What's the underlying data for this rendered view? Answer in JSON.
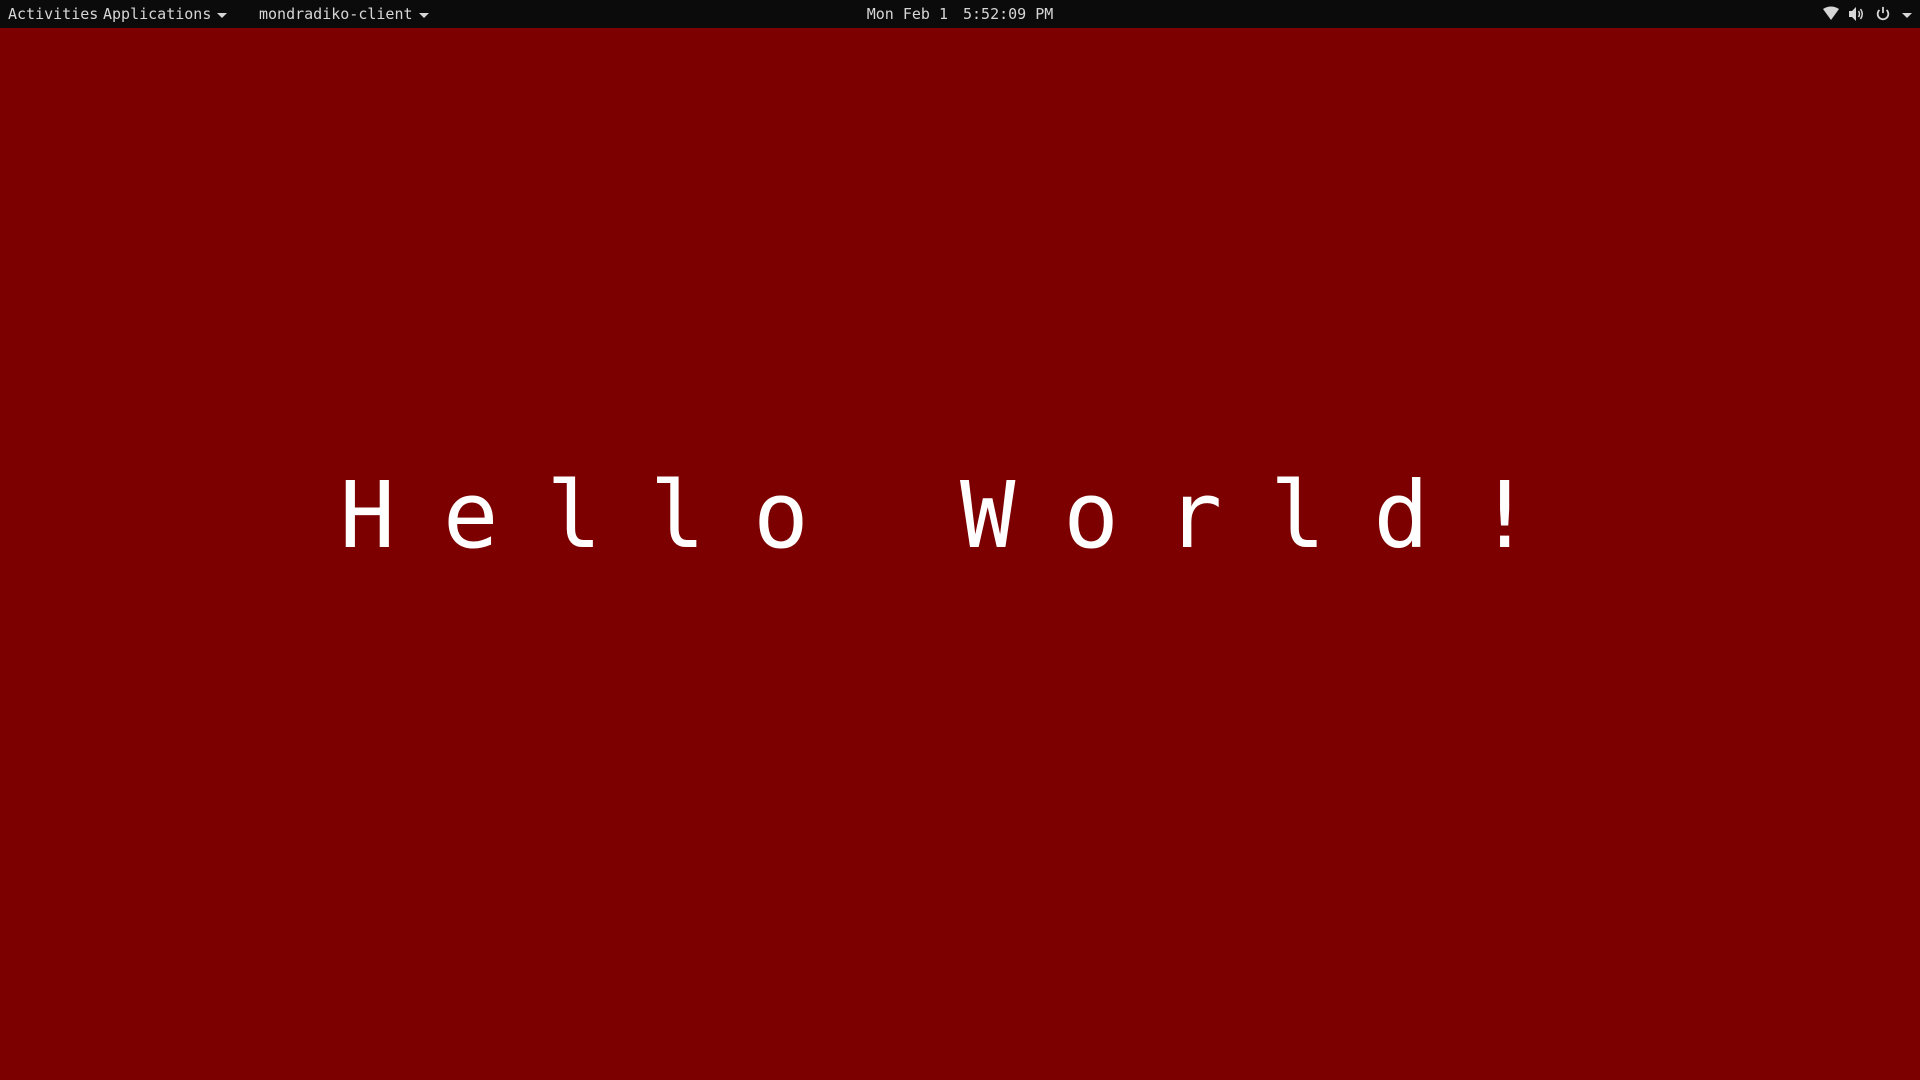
{
  "topbar": {
    "activities_label": "Activities",
    "applications_label": "Applications",
    "app_menu_label": "mondradiko-client",
    "clock": {
      "date": "Mon Feb 1",
      "time": "5:52:09 PM"
    },
    "status_icons": [
      "wifi-icon",
      "volume-icon",
      "power-icon",
      "chevron-down-icon"
    ]
  },
  "desktop": {
    "background_color": "#7d0000",
    "message": "Hello World!"
  }
}
